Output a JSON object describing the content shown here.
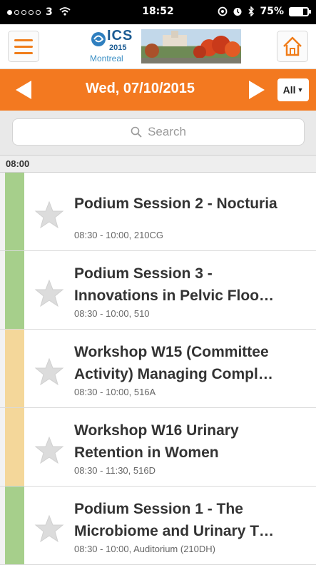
{
  "status_bar": {
    "carrier": "3",
    "time": "18:52",
    "battery": "75%",
    "signal_bars": [
      true,
      false,
      false,
      false,
      false
    ]
  },
  "header": {
    "logo": {
      "org": "ICS",
      "year": "2015",
      "city": "Montreal"
    }
  },
  "date_nav": {
    "date": "Wed, 07/10/2015",
    "filter": "All"
  },
  "search": {
    "placeholder": "Search"
  },
  "time_group": "08:00",
  "colors": {
    "accent": "#f37920",
    "green_track": "#a6cf8b",
    "yellow_track": "#f4d79a"
  },
  "sessions": [
    {
      "line1": "Podium Session 2 - Nocturia",
      "line2": "",
      "meta": "08:30 - 10:00, 210CG",
      "track": "green"
    },
    {
      "line1": "Podium Session 3 -",
      "line2": "Innovations in Pelvic Floo…",
      "meta": "08:30 - 10:00, 510",
      "track": "green"
    },
    {
      "line1": "Workshop W15 (Committee",
      "line2": "Activity) Managing Compl…",
      "meta": "08:30 - 10:00, 516A",
      "track": "yellow"
    },
    {
      "line1": "Workshop W16 Urinary",
      "line2": "Retention in Women",
      "meta": "08:30 - 11:30, 516D",
      "track": "yellow"
    },
    {
      "line1": "Podium Session 1 - The",
      "line2": "Microbiome and Urinary T…",
      "meta": "08:30 - 10:00, Auditorium (210DH)",
      "track": "green"
    }
  ]
}
